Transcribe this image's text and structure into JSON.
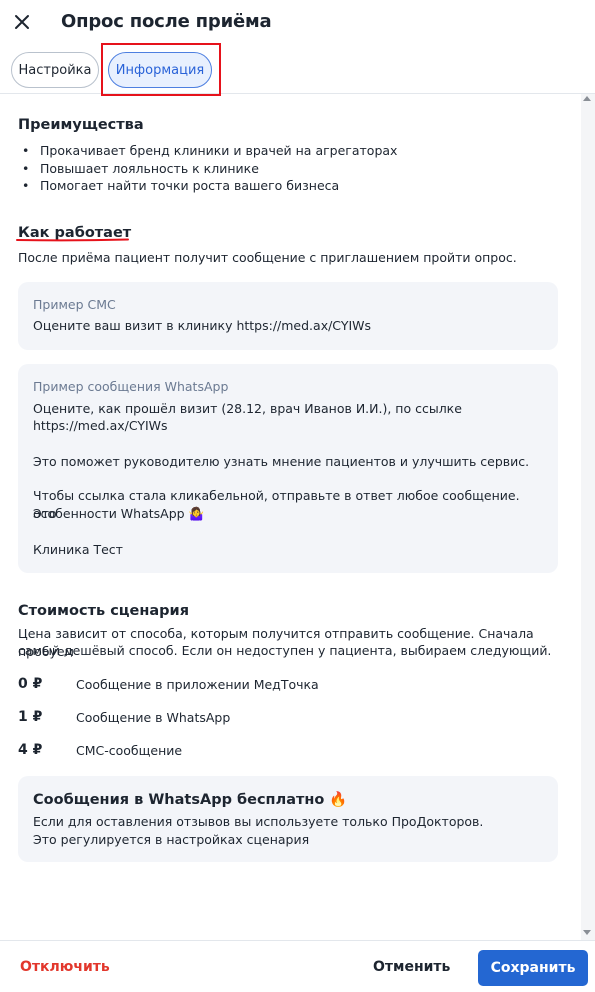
{
  "header": {
    "title": "Опрос после приёма",
    "close_icon": "close-icon"
  },
  "tabs": [
    {
      "label": "Настройка",
      "active": false
    },
    {
      "label": "Информация",
      "active": true
    }
  ],
  "benefits": {
    "title": "Преимущества",
    "items": [
      "Прокачивает бренд клиники и врачей на агрегаторах",
      "Повышает лояльность к клинике",
      "Помогает найти точки роста вашего бизнеса"
    ]
  },
  "how": {
    "title": "Как работает",
    "description": "После приёма пациент получит сообщение с приглашением пройти опрос."
  },
  "sms_example": {
    "label": "Пример СМС",
    "text": "Оцените ваш визит в клинику https://med.ax/CYIWs"
  },
  "whatsapp_example": {
    "label": "Пример сообщения WhatsApp",
    "line1": "Оцените, как прошёл визит (28.12, врач Иванов И.И.), по ссылке",
    "line2": "https://med.ax/CYIWs",
    "line3": "Это поможет руководителю узнать мнение пациентов и улучшить сервис.",
    "line4": "Чтобы ссылка стала кликабельной, отправьте в ответ любое сообщение. Это",
    "line5": "особенности WhatsApp 🤷‍♀️",
    "line6": "Клиника Тест"
  },
  "cost": {
    "title": "Стоимость сценария",
    "description_line1": "Цена зависит от способа, которым получится отправить сообщение. Сначала пробуем",
    "description_line2": "самый дешёвый способ. Если он недоступен у пациента, выбираем следующий.",
    "prices": [
      {
        "amount": "0 ₽",
        "label": "Сообщение в приложении МедТочка"
      },
      {
        "amount": "1 ₽",
        "label": "Сообщение в WhatsApp"
      },
      {
        "amount": "4 ₽",
        "label": "СМС-сообщение"
      }
    ]
  },
  "note": {
    "title": "Сообщения в WhatsApp бесплатно 🔥",
    "line1": "Если для оставления отзывов вы используете только ПроДокторов.",
    "line2": "Это регулируется в настройках сценария"
  },
  "footer": {
    "disable_label": "Отключить",
    "cancel_label": "Отменить",
    "save_label": "Сохранить"
  },
  "colors": {
    "accent": "#2467d2",
    "danger": "#e2372c",
    "highlight": "#e6121b",
    "card_bg": "#f3f5f9"
  }
}
